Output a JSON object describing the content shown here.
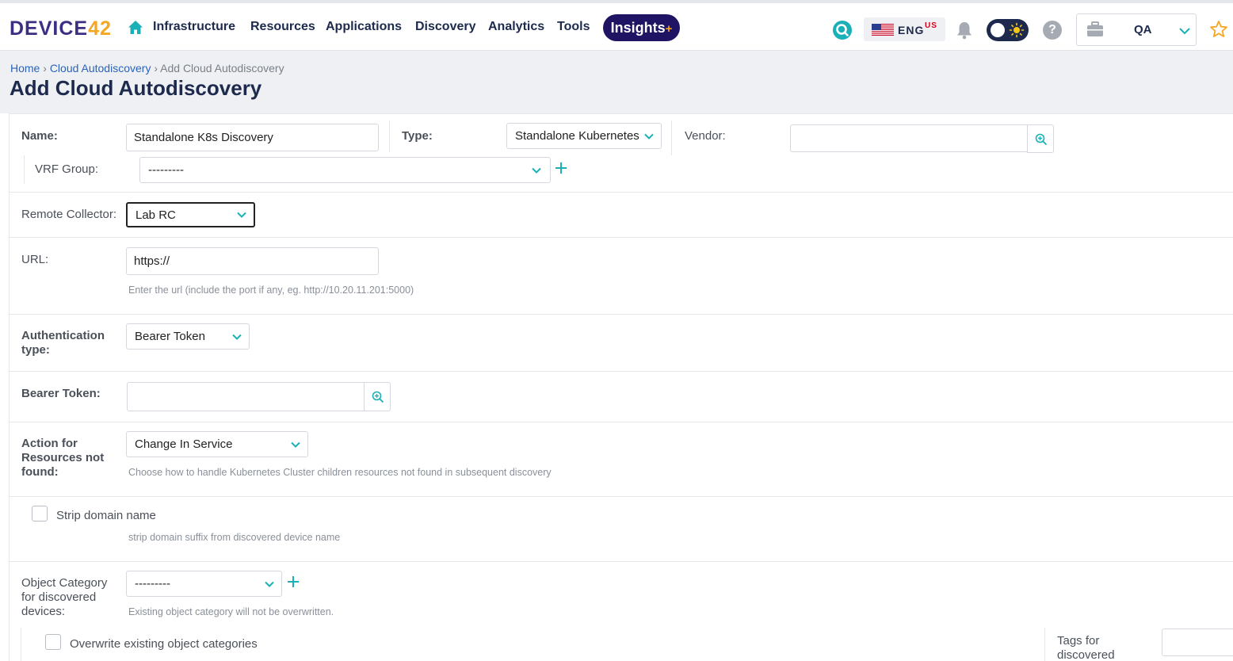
{
  "brand": {
    "logo_text": "DEVICE",
    "logo_num": "42"
  },
  "nav": {
    "items": [
      "Infrastructure",
      "Resources",
      "Applications",
      "Discovery",
      "Analytics",
      "Tools"
    ],
    "insights_label": "Insights",
    "insights_plus": "+",
    "language": "ENG",
    "language_region": "US",
    "help_glyph": "?",
    "workspace": "QA"
  },
  "breadcrumb": {
    "home": "Home",
    "sep": "›",
    "parent": "Cloud Autodiscovery",
    "current": "Add Cloud Autodiscovery"
  },
  "page_title": "Add Cloud Autodiscovery",
  "form": {
    "name_label": "Name:",
    "name_value": "Standalone K8s Discovery",
    "type_label": "Type:",
    "type_value": "Standalone Kubernetes",
    "vendor_label": "Vendor:",
    "vendor_value": "",
    "vrf_label": "VRF Group:",
    "vrf_value": "---------",
    "rc_label": "Remote Collector:",
    "rc_value": "Lab RC",
    "url_label": "URL:",
    "url_value": "https://",
    "url_hint": "Enter the url (include the port if any, eg. http://10.20.11.201:5000)",
    "auth_label": "Authentication type:",
    "auth_value": "Bearer Token",
    "token_label": "Bearer Token:",
    "token_value": "",
    "action_label": "Action for Resources not found:",
    "action_value": "Change In Service",
    "action_hint": "Choose how to handle Kubernetes Cluster children resources not found in subsequent discovery",
    "strip_label": "Strip domain name",
    "strip_hint": "strip domain suffix from discovered device name",
    "objcat_label": "Object Category for discovered devices:",
    "objcat_value": "---------",
    "objcat_hint": "Existing object category will not be overwritten.",
    "overwrite_label": "Overwrite existing object categories",
    "tags_label": "Tags for discovered"
  },
  "colors": {
    "brand": "#3b2f83",
    "accent": "#1ab0b8",
    "nav_text": "#1d2a4d",
    "insights_bg": "#1f1463",
    "link": "#2b63b8"
  }
}
